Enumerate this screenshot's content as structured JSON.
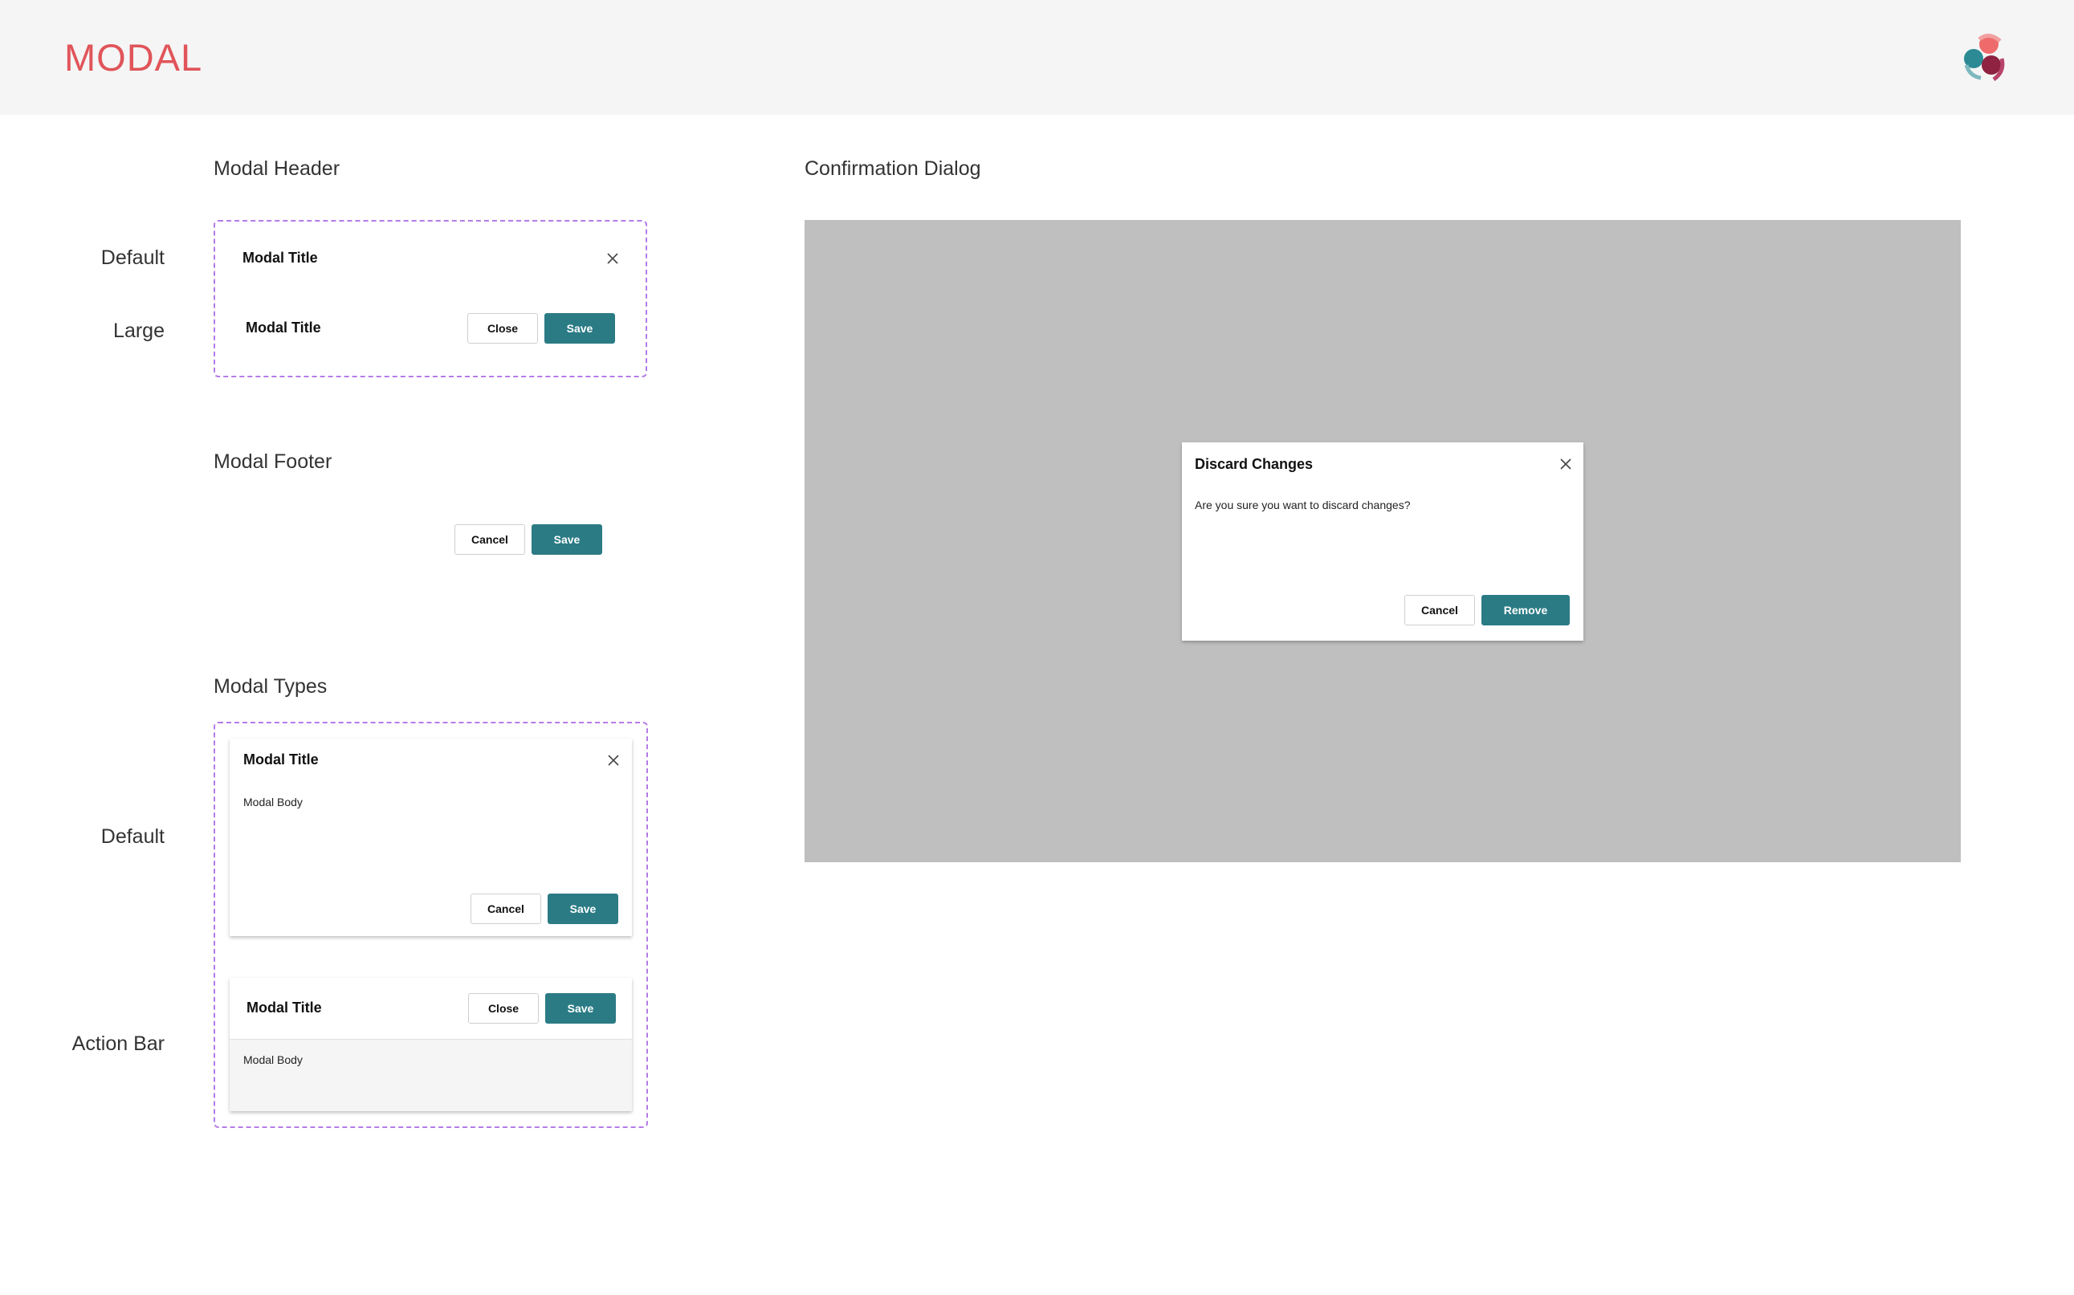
{
  "header": {
    "title": "MODAL"
  },
  "sections": {
    "modal_header": "Modal Header",
    "modal_footer": "Modal Footer",
    "modal_types": "Modal Types",
    "confirmation_dialog": "Confirmation Dialog"
  },
  "row_labels": {
    "header_default": "Default",
    "header_large": "Large",
    "types_default": "Default",
    "types_action_bar": "Action Bar"
  },
  "modal_header": {
    "default_title": "Modal Title",
    "large_title": "Modal Title",
    "close_label": "Close",
    "save_label": "Save"
  },
  "modal_footer": {
    "cancel_label": "Cancel",
    "save_label": "Save"
  },
  "modal_types": {
    "default": {
      "title": "Modal Title",
      "body": "Modal Body",
      "cancel_label": "Cancel",
      "save_label": "Save"
    },
    "action_bar": {
      "title": "Modal Title",
      "body": "Modal Body",
      "close_label": "Close",
      "save_label": "Save"
    }
  },
  "confirmation_dialog": {
    "title": "Discard Changes",
    "message": "Are you sure you want to discard changes?",
    "cancel_label": "Cancel",
    "remove_label": "Remove"
  },
  "colors": {
    "brand_title": "#e0555a",
    "primary_button": "#2b7b85",
    "dashed_border": "#b57be8",
    "overlay": "#bfbfbf"
  },
  "icons": {
    "close": "close-icon",
    "logo": "brand-logo-icon"
  }
}
